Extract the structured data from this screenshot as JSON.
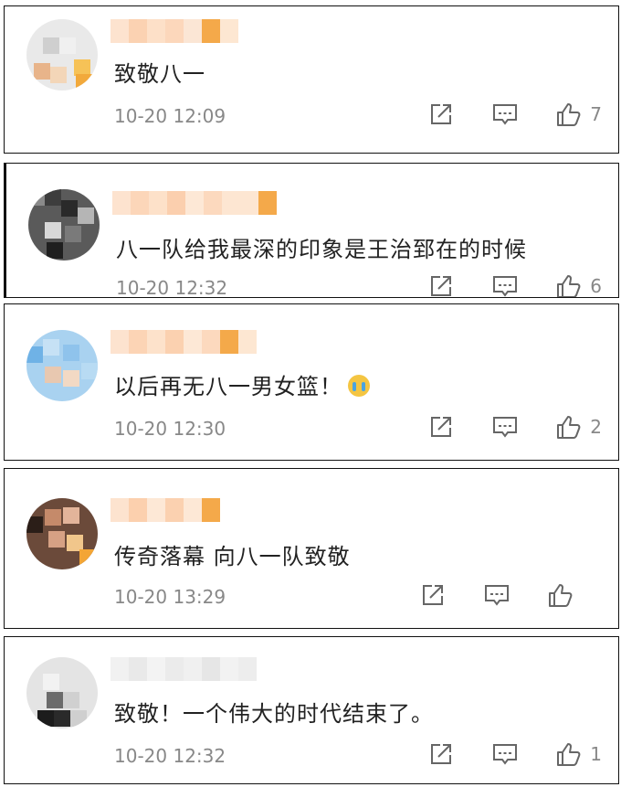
{
  "comments": [
    {
      "text": "致敬八一",
      "time": "10-20 12:09",
      "likes": "7",
      "emoji": false
    },
    {
      "text": "八一队给我最深的印象是王治郅在的时候",
      "time": "10-20 12:32",
      "likes": "6",
      "emoji": false
    },
    {
      "text": "以后再无八一男女篮！",
      "time": "10-20 12:30",
      "likes": "2",
      "emoji": true
    },
    {
      "text": "传奇落幕 向八一队致敬",
      "time": "10-20 13:29",
      "likes": "",
      "emoji": false
    },
    {
      "text": "致敬！一个伟大的时代结束了。",
      "time": "10-20 12:32",
      "likes": "1",
      "emoji": false
    }
  ],
  "icons": {
    "share": "share-icon",
    "reply": "reply-icon",
    "like": "like-icon"
  },
  "colors": {
    "meta_text": "#888888",
    "icon": "#666666",
    "blur_orange": "#f5a623"
  }
}
